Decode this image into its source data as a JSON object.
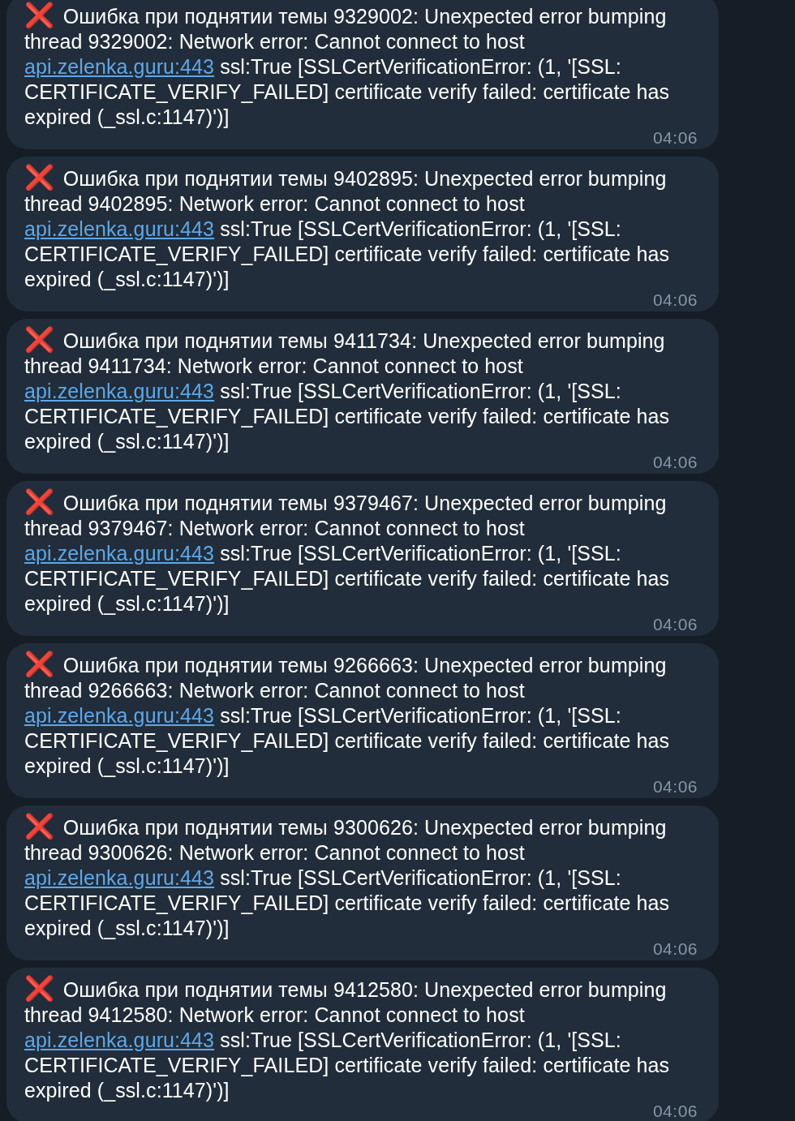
{
  "messages": [
    {
      "icon": "❌ ",
      "text_before": "Ошибка при поднятии темы 9329002: Unexpected error bumping thread 9329002: Network error: Cannot connect to host ",
      "link": "api.zelenka.guru:443",
      "text_after": " ssl:True [SSLCertVerificationError: (1, '[SSL: CERTIFICATE_VERIFY_FAILED] certificate verify failed: certificate has expired (_ssl.c:1147)')]",
      "time": "04:06"
    },
    {
      "icon": "❌ ",
      "text_before": "Ошибка при поднятии темы 9402895: Unexpected error bumping thread 9402895: Network error: Cannot connect to host ",
      "link": "api.zelenka.guru:443",
      "text_after": " ssl:True [SSLCertVerificationError: (1, '[SSL: CERTIFICATE_VERIFY_FAILED] certificate verify failed: certificate has expired (_ssl.c:1147)')]",
      "time": "04:06"
    },
    {
      "icon": "❌ ",
      "text_before": "Ошибка при поднятии темы 9411734: Unexpected error bumping thread 9411734: Network error: Cannot connect to host ",
      "link": "api.zelenka.guru:443",
      "text_after": " ssl:True [SSLCertVerificationError: (1, '[SSL: CERTIFICATE_VERIFY_FAILED] certificate verify failed: certificate has expired (_ssl.c:1147)')]",
      "time": "04:06"
    },
    {
      "icon": "❌ ",
      "text_before": "Ошибка при поднятии темы 9379467: Unexpected error bumping thread 9379467: Network error: Cannot connect to host ",
      "link": "api.zelenka.guru:443",
      "text_after": " ssl:True [SSLCertVerificationError: (1, '[SSL: CERTIFICATE_VERIFY_FAILED] certificate verify failed: certificate has expired (_ssl.c:1147)')]",
      "time": "04:06"
    },
    {
      "icon": "❌ ",
      "text_before": "Ошибка при поднятии темы 9266663: Unexpected error bumping thread 9266663: Network error: Cannot connect to host ",
      "link": "api.zelenka.guru:443",
      "text_after": " ssl:True [SSLCertVerificationError: (1, '[SSL: CERTIFICATE_VERIFY_FAILED] certificate verify failed: certificate has expired (_ssl.c:1147)')]",
      "time": "04:06"
    },
    {
      "icon": "❌ ",
      "text_before": "Ошибка при поднятии темы 9300626: Unexpected error bumping thread 9300626: Network error: Cannot connect to host ",
      "link": "api.zelenka.guru:443",
      "text_after": " ssl:True [SSLCertVerificationError: (1, '[SSL: CERTIFICATE_VERIFY_FAILED] certificate verify failed: certificate has expired (_ssl.c:1147)')]",
      "time": "04:06"
    },
    {
      "icon": "❌ ",
      "text_before": "Ошибка при поднятии темы 9412580: Unexpected error bumping thread 9412580: Network error: Cannot connect to host ",
      "link": "api.zelenka.guru:443",
      "text_after": " ssl:True [SSLCertVerificationError: (1, '[SSL: CERTIFICATE_VERIFY_FAILED] certificate verify failed: certificate has expired (_ssl.c:1147)')]",
      "time": "04:06"
    }
  ]
}
